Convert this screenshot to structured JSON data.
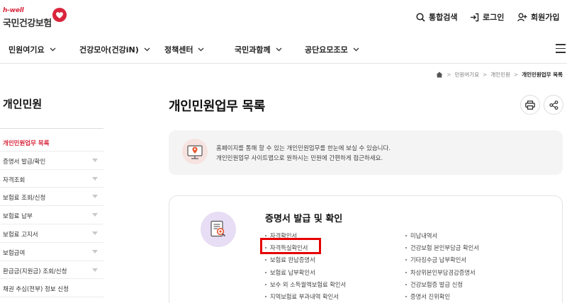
{
  "header": {
    "logo_small": "h-well",
    "logo_main": "국민건강보험",
    "utils": {
      "search": "통합검색",
      "login": "로그인",
      "join": "회원가입"
    }
  },
  "gnb": {
    "items": [
      "민원여기요",
      "건강모아(건강iN)",
      "정책센터",
      "국민과함께",
      "공단요모조모"
    ]
  },
  "breadcrumb": {
    "items": [
      "민원여기요",
      "개인민원",
      "개인민원업무 목록"
    ]
  },
  "sidebar": {
    "title": "개인민원",
    "items": [
      {
        "label": "개인민원업무 목록",
        "active": true,
        "has_sub": false
      },
      {
        "label": "증명서 발급/확인",
        "active": false,
        "has_sub": true
      },
      {
        "label": "자격조회",
        "active": false,
        "has_sub": true
      },
      {
        "label": "보험료 조회/신청",
        "active": false,
        "has_sub": true
      },
      {
        "label": "보험료 납부",
        "active": false,
        "has_sub": true
      },
      {
        "label": "보험료 고지서",
        "active": false,
        "has_sub": true
      },
      {
        "label": "보험급여",
        "active": false,
        "has_sub": true
      },
      {
        "label": "환급금(지원금) 조회/신청",
        "active": false,
        "has_sub": true
      },
      {
        "label": "채권 추심(전부) 정보 신청",
        "active": false,
        "has_sub": false
      }
    ]
  },
  "main": {
    "title": "개인민원업무 목록",
    "notice": {
      "line1": "홈페이지를 통해 할 수 있는 개인민원업무를 한눈에 보실 수 있습니다.",
      "line2": "개인민원업무 사이트맵으로 원하시는 민원에 간편하게 접근하세요."
    },
    "card": {
      "title": "증명서 발급 및 확인",
      "left_items": [
        "자격확인서",
        "자격득실확인서",
        "보험료 완납증명서",
        "보험료 납부확인서",
        "보수 외 소득월액보험료 확인서",
        "지역보험료 부과내역 확인서"
      ],
      "right_items": [
        "미납내역서",
        "건강보험 본인부담금 확인서",
        "기타징수금 납부확인서",
        "차상위본인부담경감증명서",
        "건강보험증 발급 신청",
        "증명서 진위확인"
      ],
      "highlighted_item": "자격득실확인서"
    }
  },
  "colors": {
    "brand_red": "#d9263c",
    "highlight_red": "#e60000",
    "icon_lilac": "#e7ddf4"
  }
}
